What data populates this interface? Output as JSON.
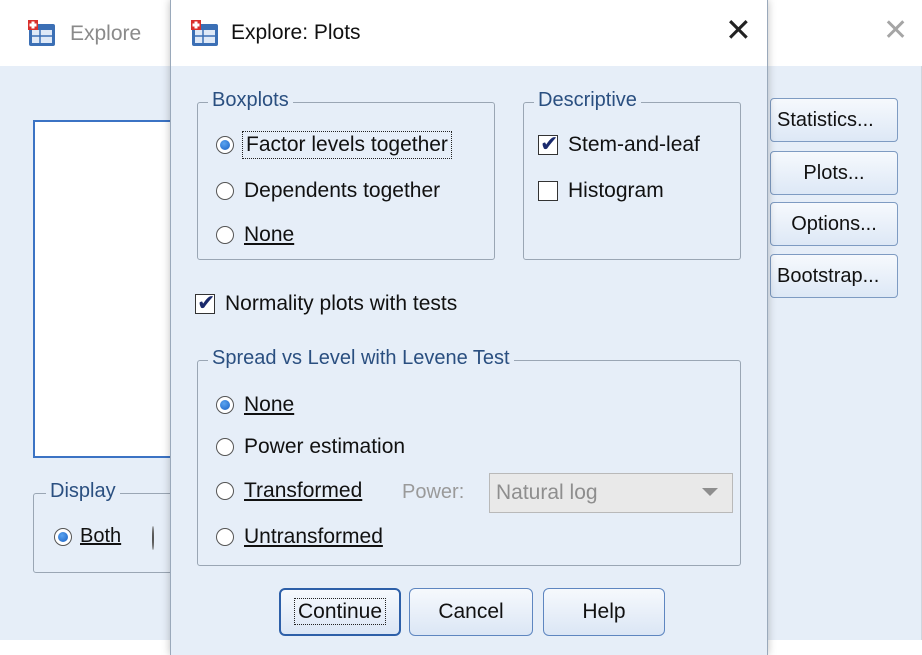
{
  "background_window": {
    "title": "Explore",
    "display_group": {
      "legend": "Display",
      "both_label": "Both"
    },
    "side_buttons": [
      "Statistics...",
      "Plots...",
      "Options...",
      "Bootstrap..."
    ]
  },
  "dialog": {
    "title": "Explore: Plots",
    "boxplots": {
      "legend": "Boxplots",
      "options": [
        "Factor levels together",
        "Dependents together",
        "None"
      ],
      "selected": "Factor levels together"
    },
    "descriptive": {
      "legend": "Descriptive",
      "stem_and_leaf": "Stem-and-leaf",
      "stem_and_leaf_checked": true,
      "histogram": "Histogram",
      "histogram_checked": false
    },
    "normality": {
      "label": "Normality plots with tests",
      "checked": true
    },
    "spread": {
      "legend": "Spread vs Level with Levene Test",
      "options": [
        "None",
        "Power estimation",
        "Transformed",
        "Untransformed"
      ],
      "selected": "None",
      "power_label": "Power:",
      "power_value": "Natural log"
    },
    "buttons": {
      "continue": "Continue",
      "cancel": "Cancel",
      "help": "Help"
    }
  }
}
